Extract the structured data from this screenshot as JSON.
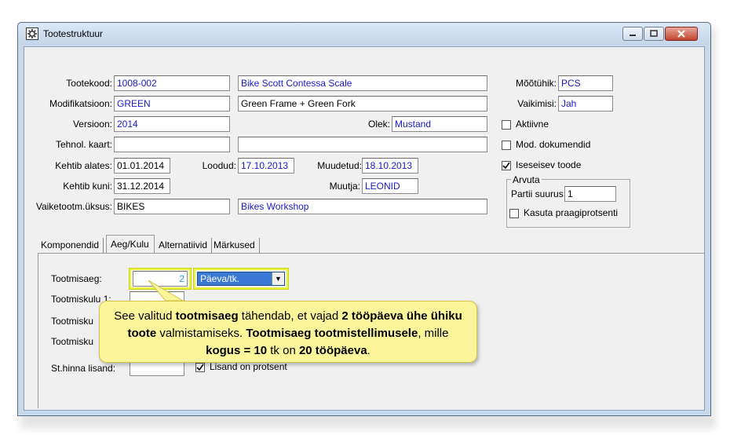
{
  "window": {
    "title": "Tootestruktuur"
  },
  "form": {
    "tootekood": {
      "label": "Tootekood:",
      "value": "1008-002",
      "desc": "Bike Scott Contessa Scale"
    },
    "modifikatsioon": {
      "label": "Modifikatsioon:",
      "value": "GREEN",
      "desc": "Green Frame + Green Fork"
    },
    "versioon": {
      "label": "Versioon:",
      "value": "2014"
    },
    "olek": {
      "label": "Olek:",
      "value": "Mustand"
    },
    "tehnol_kaart": {
      "label": "Tehnol. kaart:",
      "value": "",
      "desc": ""
    },
    "kehtib_alates": {
      "label": "Kehtib alates:",
      "value": "01.01.2014"
    },
    "loodud": {
      "label": "Loodud:",
      "value": "17.10.2013"
    },
    "muudetud": {
      "label": "Muudetud:",
      "value": "18.10.2013"
    },
    "kehtib_kuni": {
      "label": "Kehtib kuni:",
      "value": "31.12.2014"
    },
    "muutja": {
      "label": "Muutja:",
      "value": "LEONID"
    },
    "vaiketootm": {
      "label": "Vaiketootm.üksus:",
      "value": "BIKES",
      "desc": "Bikes Workshop"
    },
    "mootuhik": {
      "label": "Mõõtühik:",
      "value": "PCS"
    },
    "vaikimisi": {
      "label": "Vaikimisi:",
      "value": "Jah"
    },
    "aktiivne": {
      "label": "Aktiivne",
      "checked": false
    },
    "mod_dokumendid": {
      "label": "Mod. dokumendid",
      "checked": false
    },
    "iseseisev_toode": {
      "label": "Iseseisev toode",
      "checked": true
    },
    "arvuta": {
      "title": "Arvuta",
      "partii_label": "Partii suurus:",
      "partii_value": "1",
      "praak_label": "Kasuta praagiprotsenti",
      "praak_checked": false
    }
  },
  "tabs": [
    {
      "label": "Komponendid"
    },
    {
      "label": "Aeg/Kulu"
    },
    {
      "label": "Alternatiivid"
    },
    {
      "label": "Märkused"
    }
  ],
  "panel": {
    "tootmisaeg_label": "Tootmisaeg:",
    "tootmisaeg_value": "2",
    "unit_value": "Päeva/tk.",
    "tootmiskulu1_label": "Tootmiskulu 1:",
    "tootmiskulu2_label": "Tootmisku",
    "tootmiskulu3_label": "Tootmisku",
    "sthinna_label": "St.hinna lisand:",
    "lisand_protsent_label": "Lisand on protsent",
    "lisand_protsent_checked": true
  },
  "callout": {
    "t1": "See valitud ",
    "t2": "tootmisaeg",
    "t3": " tähendab, et vajad ",
    "t4": "2 tööpäeva ühe ühiku toote",
    "t5": " valmistamiseks. ",
    "t6": "Tootmisaeg tootmistellimusele",
    "t7": ", mille ",
    "t8": "kogus = 10",
    "t9": " tk on ",
    "t10": "20 tööpäeva",
    "t11": "."
  },
  "colors": {
    "field_text_blue": "#1a1ac8",
    "highlight_yellow": "#e8f33a",
    "callout_bg": "#fdf59a",
    "combo_selected": "#3a7ad6"
  }
}
